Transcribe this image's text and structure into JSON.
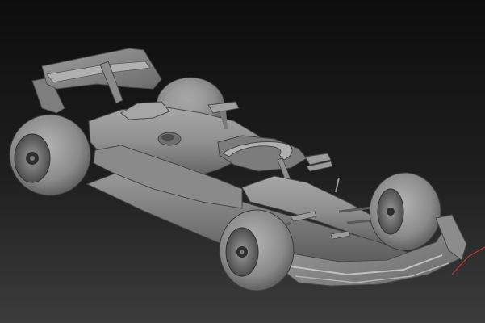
{
  "viewport": {
    "subject": "formula-1-car-clay-render",
    "background_colors": {
      "top": "#0e0e0e",
      "bottom": "#3a3a3a"
    },
    "model_color": "#8c8c8c",
    "gizmo_color": "#c0392b"
  }
}
